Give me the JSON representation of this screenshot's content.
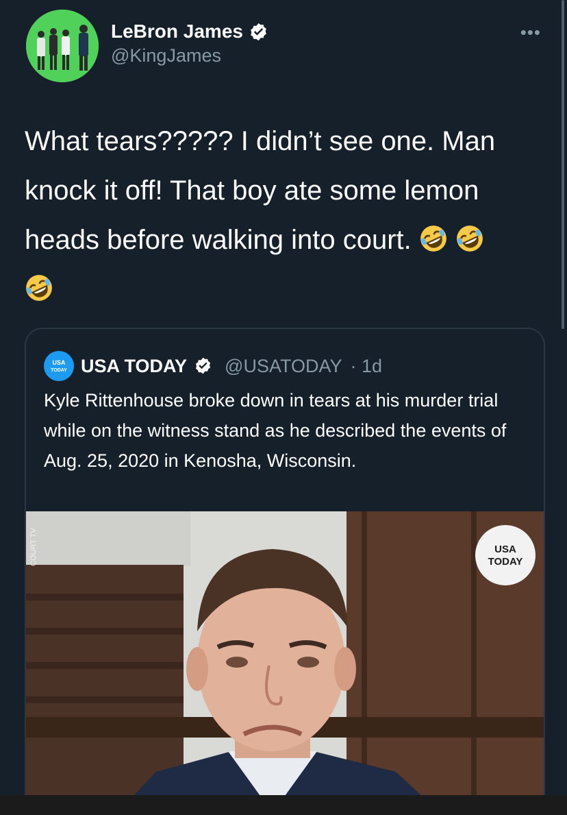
{
  "tweet": {
    "author_name": "LeBron James",
    "author_handle": "@KingJames",
    "more_label": "•••",
    "text_line1": "What tears????? I didn’t see one. Man",
    "text_line2": "knock it off! That boy ate some lemon",
    "text_line3": "heads before walking into court.",
    "emoji": "rolling-on-floor-laughing-emoji",
    "emoji_count": 3
  },
  "quoted": {
    "author_name": "USA TODAY",
    "author_handle": "@USATODAY",
    "time": "· 1d",
    "text": "Kyle Rittenhouse broke down in tears at his murder trial while on the witness stand as he described the events of Aug. 25, 2020 in Kenosha, Wisconsin.",
    "image_watermark_line1": "USA",
    "image_watermark_line2": "TODAY",
    "image_side_text": "COURT TV",
    "avatar_text": "USA TODAY"
  },
  "colors": {
    "background": "#15202b",
    "secondary_text": "#8899a6",
    "verified_blue": "#ffffff",
    "border": "#2a3744",
    "avatar_green": "#4fd15a"
  }
}
